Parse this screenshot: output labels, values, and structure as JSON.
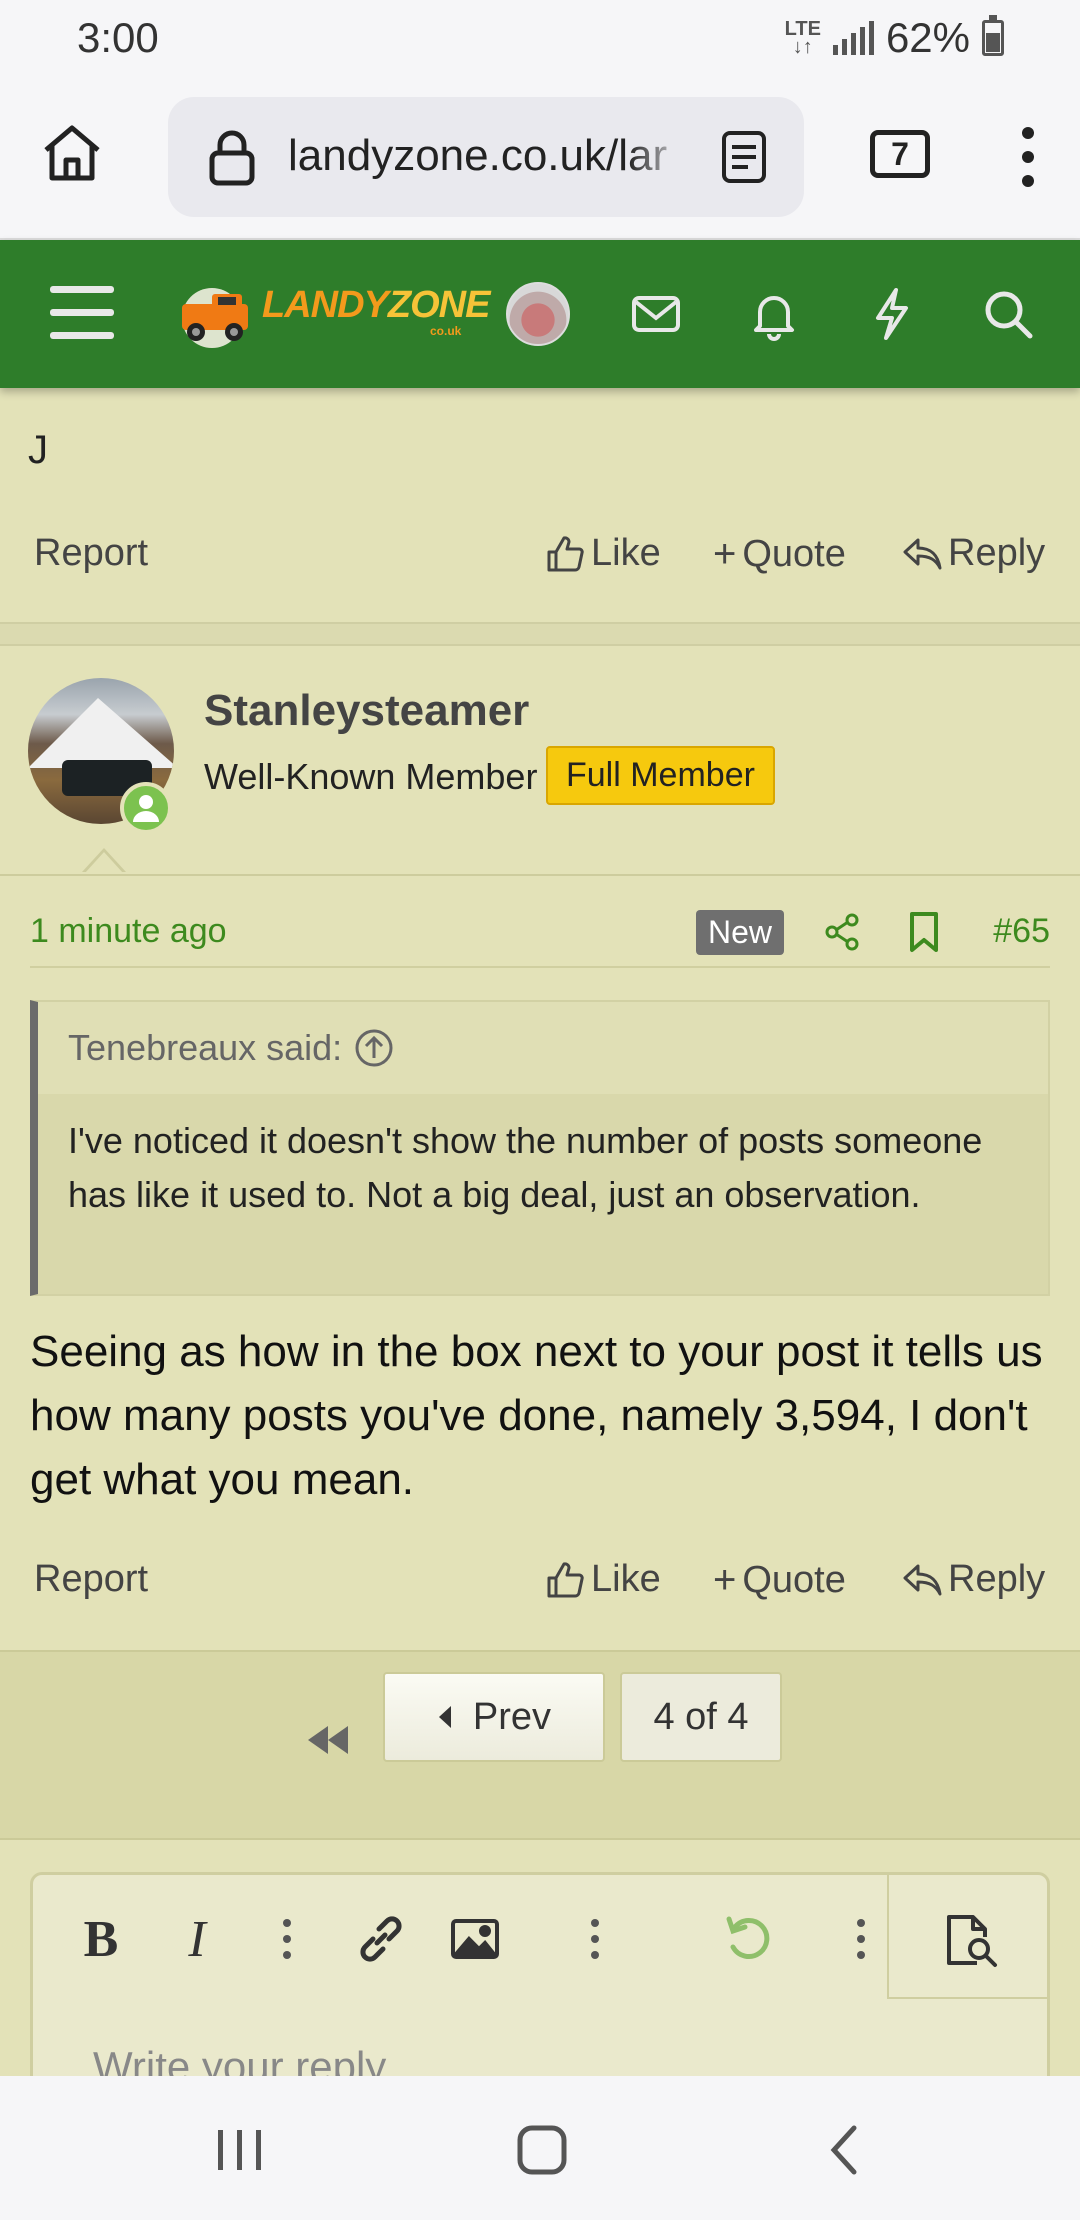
{
  "status_bar": {
    "time": "3:00",
    "network": "LTE",
    "battery": "62%"
  },
  "browser": {
    "url": "landyzone.co.uk/lar",
    "tab_count": "7"
  },
  "site": {
    "logo_text_a": "LANDY",
    "logo_text_b": "ZONE",
    "logo_suffix": "co.uk"
  },
  "previous_post": {
    "text": "J",
    "actions": {
      "report": "Report",
      "like": "Like",
      "quote": "Quote",
      "reply": "Reply"
    }
  },
  "post": {
    "author": "Stanleysteamer",
    "user_title": "Well-Known Member",
    "badge": "Full Member",
    "time_ago": "1 minute ago",
    "new_label": "New",
    "post_number": "#65",
    "quote": {
      "author_line": "Tenebreaux said:",
      "text": "I've noticed it doesn't show the number of posts someone has like it used to. Not a big deal, just an observation."
    },
    "body": "Seeing as how in the box next to your post it tells us how many posts you've done, namely 3,594, I don't get what you mean.",
    "actions": {
      "report": "Report",
      "like": "Like",
      "quote": "Quote",
      "reply": "Reply"
    }
  },
  "pagination": {
    "prev_label": "Prev",
    "current": "4 of 4"
  },
  "editor": {
    "placeholder": "Write your reply..."
  },
  "colors": {
    "header": "#2e7d2a",
    "accent_green": "#3d8a1e",
    "badge": "#f6c90e",
    "page_bg": "#e3e2b8"
  }
}
